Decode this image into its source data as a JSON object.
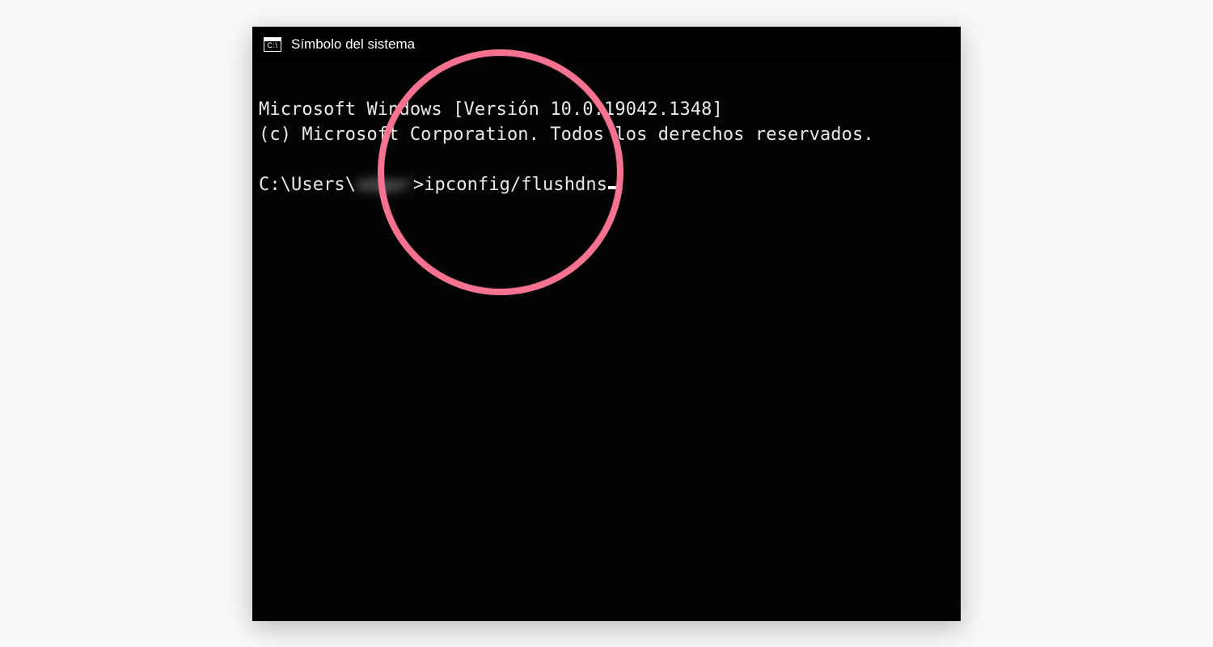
{
  "window": {
    "title": "Símbolo del sistema",
    "icon_label": "C:\\"
  },
  "terminal": {
    "line1": "Microsoft Windows [Versión 10.0.19042.1348]",
    "line2": "(c) Microsoft Corporation. Todos los derechos reservados.",
    "prompt_prefix": "C:\\Users\\",
    "prompt_user_blurred": "edgar",
    "prompt_suffix": ">",
    "command": "ipconfig/flushdns"
  },
  "annotation": {
    "circle_color": "#f57290"
  }
}
